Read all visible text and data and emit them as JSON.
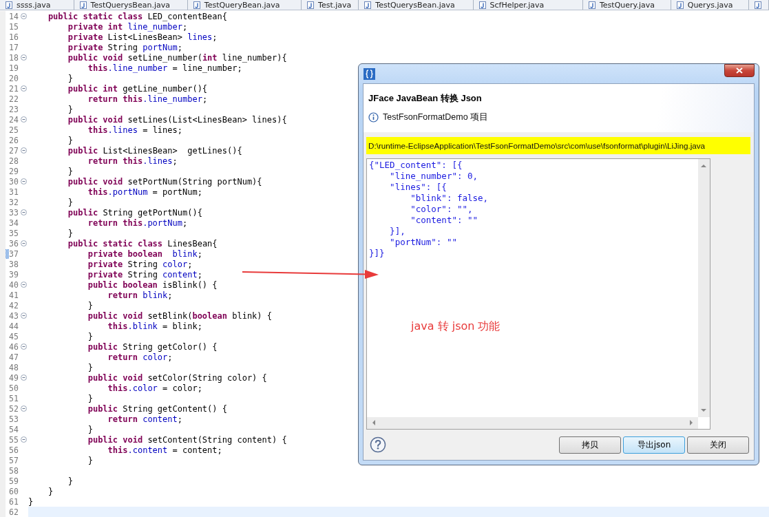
{
  "tabs": [
    {
      "label": "ssss.java",
      "selected": false
    },
    {
      "label": "TestQuerysBean.java",
      "selected": false
    },
    {
      "label": "TestQueryBean.java",
      "selected": false
    },
    {
      "label": "Test.java",
      "selected": false
    },
    {
      "label": "TestQuerysBean.java",
      "selected": false
    },
    {
      "label": "ScfHelper.java",
      "selected": false
    },
    {
      "label": "TestQuery.java",
      "selected": false
    },
    {
      "label": "Querys.java",
      "selected": false
    },
    {
      "selected": false
    }
  ],
  "editor": {
    "lines": [
      {
        "number": "14",
        "fold": true,
        "marked": false,
        "current": false,
        "segments": [
          {
            "kind": "kw",
            "text": "    public static class"
          },
          {
            "kind": "plain",
            "text": " LED_contentBean{"
          }
        ]
      },
      {
        "number": "15",
        "fold": false,
        "marked": false,
        "current": false,
        "segments": [
          {
            "kind": "kw",
            "text": "        private int"
          },
          {
            "kind": "field",
            "text": " line_number"
          },
          {
            "kind": "plain",
            "text": ";"
          }
        ]
      },
      {
        "number": "16",
        "fold": false,
        "marked": false,
        "current": false,
        "segments": [
          {
            "kind": "kw",
            "text": "        private"
          },
          {
            "kind": "plain",
            "text": " List<LinesBean>"
          },
          {
            "kind": "field",
            "text": " lines"
          },
          {
            "kind": "plain",
            "text": ";"
          }
        ]
      },
      {
        "number": "17",
        "fold": false,
        "marked": false,
        "current": false,
        "segments": [
          {
            "kind": "kw",
            "text": "        private"
          },
          {
            "kind": "plain",
            "text": " String"
          },
          {
            "kind": "field",
            "text": " portNum"
          },
          {
            "kind": "plain",
            "text": ";"
          }
        ]
      },
      {
        "number": "18",
        "fold": true,
        "marked": false,
        "current": false,
        "segments": [
          {
            "kind": "kw",
            "text": "        public void"
          },
          {
            "kind": "plain",
            "text": " setLine_number("
          },
          {
            "kind": "kw",
            "text": "int"
          },
          {
            "kind": "plain",
            "text": " line_number){"
          }
        ]
      },
      {
        "number": "19",
        "fold": false,
        "marked": false,
        "current": false,
        "segments": [
          {
            "kind": "kw",
            "text": "            this"
          },
          {
            "kind": "field",
            "text": ".line_number"
          },
          {
            "kind": "plain",
            "text": " = line_number;"
          }
        ]
      },
      {
        "number": "20",
        "fold": false,
        "marked": false,
        "current": false,
        "segments": [
          {
            "kind": "plain",
            "text": "        }"
          }
        ]
      },
      {
        "number": "21",
        "fold": true,
        "marked": false,
        "current": false,
        "segments": [
          {
            "kind": "kw",
            "text": "        public int"
          },
          {
            "kind": "plain",
            "text": " getLine_number(){"
          }
        ]
      },
      {
        "number": "22",
        "fold": false,
        "marked": false,
        "current": false,
        "segments": [
          {
            "kind": "kw",
            "text": "            return this"
          },
          {
            "kind": "field",
            "text": ".line_number"
          },
          {
            "kind": "plain",
            "text": ";"
          }
        ]
      },
      {
        "number": "23",
        "fold": false,
        "marked": false,
        "current": false,
        "segments": [
          {
            "kind": "plain",
            "text": "        }"
          }
        ]
      },
      {
        "number": "24",
        "fold": true,
        "marked": false,
        "current": false,
        "segments": [
          {
            "kind": "kw",
            "text": "        public void"
          },
          {
            "kind": "plain",
            "text": " setLines(List<LinesBean> lines){"
          }
        ]
      },
      {
        "number": "25",
        "fold": false,
        "marked": false,
        "current": false,
        "segments": [
          {
            "kind": "kw",
            "text": "            this"
          },
          {
            "kind": "field",
            "text": ".lines"
          },
          {
            "kind": "plain",
            "text": " = lines;"
          }
        ]
      },
      {
        "number": "26",
        "fold": false,
        "marked": false,
        "current": false,
        "segments": [
          {
            "kind": "plain",
            "text": "        }"
          }
        ]
      },
      {
        "number": "27",
        "fold": true,
        "marked": false,
        "current": false,
        "segments": [
          {
            "kind": "kw",
            "text": "        public"
          },
          {
            "kind": "plain",
            "text": " List<LinesBean>  getLines(){"
          }
        ]
      },
      {
        "number": "28",
        "fold": false,
        "marked": false,
        "current": false,
        "segments": [
          {
            "kind": "kw",
            "text": "            return this"
          },
          {
            "kind": "field",
            "text": ".lines"
          },
          {
            "kind": "plain",
            "text": ";"
          }
        ]
      },
      {
        "number": "29",
        "fold": false,
        "marked": false,
        "current": false,
        "segments": [
          {
            "kind": "plain",
            "text": "        }"
          }
        ]
      },
      {
        "number": "30",
        "fold": true,
        "marked": false,
        "current": false,
        "segments": [
          {
            "kind": "kw",
            "text": "        public void"
          },
          {
            "kind": "plain",
            "text": " setPortNum(String portNum){"
          }
        ]
      },
      {
        "number": "31",
        "fold": false,
        "marked": false,
        "current": false,
        "segments": [
          {
            "kind": "kw",
            "text": "            this"
          },
          {
            "kind": "field",
            "text": ".portNum"
          },
          {
            "kind": "plain",
            "text": " = portNum;"
          }
        ]
      },
      {
        "number": "32",
        "fold": false,
        "marked": false,
        "current": false,
        "segments": [
          {
            "kind": "plain",
            "text": "        }"
          }
        ]
      },
      {
        "number": "33",
        "fold": true,
        "marked": false,
        "current": false,
        "segments": [
          {
            "kind": "kw",
            "text": "        public"
          },
          {
            "kind": "plain",
            "text": " String getPortNum(){"
          }
        ]
      },
      {
        "number": "34",
        "fold": false,
        "marked": false,
        "current": false,
        "segments": [
          {
            "kind": "kw",
            "text": "            return this"
          },
          {
            "kind": "field",
            "text": ".portNum"
          },
          {
            "kind": "plain",
            "text": ";"
          }
        ]
      },
      {
        "number": "35",
        "fold": false,
        "marked": false,
        "current": false,
        "segments": [
          {
            "kind": "plain",
            "text": "        }"
          }
        ]
      },
      {
        "number": "36",
        "fold": true,
        "marked": false,
        "current": false,
        "segments": [
          {
            "kind": "kw",
            "text": "        public static class"
          },
          {
            "kind": "plain",
            "text": " LinesBean{"
          }
        ]
      },
      {
        "number": "37",
        "fold": false,
        "marked": true,
        "current": false,
        "segments": [
          {
            "kind": "kw",
            "text": "            private boolean"
          },
          {
            "kind": "field",
            "text": "  blink"
          },
          {
            "kind": "plain",
            "text": ";"
          }
        ]
      },
      {
        "number": "38",
        "fold": false,
        "marked": false,
        "current": false,
        "segments": [
          {
            "kind": "kw",
            "text": "            private"
          },
          {
            "kind": "plain",
            "text": " String"
          },
          {
            "kind": "field",
            "text": " color"
          },
          {
            "kind": "plain",
            "text": ";"
          }
        ]
      },
      {
        "number": "39",
        "fold": false,
        "marked": false,
        "current": false,
        "segments": [
          {
            "kind": "kw",
            "text": "            private"
          },
          {
            "kind": "plain",
            "text": " String"
          },
          {
            "kind": "field",
            "text": " content"
          },
          {
            "kind": "plain",
            "text": ";"
          }
        ]
      },
      {
        "number": "40",
        "fold": true,
        "marked": false,
        "current": false,
        "segments": [
          {
            "kind": "kw",
            "text": "            public boolean"
          },
          {
            "kind": "plain",
            "text": " isBlink() {"
          }
        ]
      },
      {
        "number": "41",
        "fold": false,
        "marked": false,
        "current": false,
        "segments": [
          {
            "kind": "kw",
            "text": "                return"
          },
          {
            "kind": "field",
            "text": " blink"
          },
          {
            "kind": "plain",
            "text": ";"
          }
        ]
      },
      {
        "number": "42",
        "fold": false,
        "marked": false,
        "current": false,
        "segments": [
          {
            "kind": "plain",
            "text": "            }"
          }
        ]
      },
      {
        "number": "43",
        "fold": true,
        "marked": false,
        "current": false,
        "segments": [
          {
            "kind": "kw",
            "text": "            public void"
          },
          {
            "kind": "plain",
            "text": " setBlink("
          },
          {
            "kind": "kw",
            "text": "boolean"
          },
          {
            "kind": "plain",
            "text": " blink) {"
          }
        ]
      },
      {
        "number": "44",
        "fold": false,
        "marked": false,
        "current": false,
        "segments": [
          {
            "kind": "kw",
            "text": "                this"
          },
          {
            "kind": "field",
            "text": ".blink"
          },
          {
            "kind": "plain",
            "text": " = blink;"
          }
        ]
      },
      {
        "number": "45",
        "fold": false,
        "marked": false,
        "current": false,
        "segments": [
          {
            "kind": "plain",
            "text": "            }"
          }
        ]
      },
      {
        "number": "46",
        "fold": true,
        "marked": false,
        "current": false,
        "segments": [
          {
            "kind": "kw",
            "text": "            public"
          },
          {
            "kind": "plain",
            "text": " String getColor() {"
          }
        ]
      },
      {
        "number": "47",
        "fold": false,
        "marked": false,
        "current": false,
        "segments": [
          {
            "kind": "kw",
            "text": "                return"
          },
          {
            "kind": "field",
            "text": " color"
          },
          {
            "kind": "plain",
            "text": ";"
          }
        ]
      },
      {
        "number": "48",
        "fold": false,
        "marked": false,
        "current": false,
        "segments": [
          {
            "kind": "plain",
            "text": "            }"
          }
        ]
      },
      {
        "number": "49",
        "fold": true,
        "marked": false,
        "current": false,
        "segments": [
          {
            "kind": "kw",
            "text": "            public void"
          },
          {
            "kind": "plain",
            "text": " setColor(String color) {"
          }
        ]
      },
      {
        "number": "50",
        "fold": false,
        "marked": false,
        "current": false,
        "segments": [
          {
            "kind": "kw",
            "text": "                this"
          },
          {
            "kind": "field",
            "text": ".color"
          },
          {
            "kind": "plain",
            "text": " = color;"
          }
        ]
      },
      {
        "number": "51",
        "fold": false,
        "marked": false,
        "current": false,
        "segments": [
          {
            "kind": "plain",
            "text": "            }"
          }
        ]
      },
      {
        "number": "52",
        "fold": true,
        "marked": false,
        "current": false,
        "segments": [
          {
            "kind": "kw",
            "text": "            public"
          },
          {
            "kind": "plain",
            "text": " String getContent() {"
          }
        ]
      },
      {
        "number": "53",
        "fold": false,
        "marked": false,
        "current": false,
        "segments": [
          {
            "kind": "kw",
            "text": "                return"
          },
          {
            "kind": "field",
            "text": " content"
          },
          {
            "kind": "plain",
            "text": ";"
          }
        ]
      },
      {
        "number": "54",
        "fold": false,
        "marked": false,
        "current": false,
        "segments": [
          {
            "kind": "plain",
            "text": "            }"
          }
        ]
      },
      {
        "number": "55",
        "fold": true,
        "marked": false,
        "current": false,
        "segments": [
          {
            "kind": "kw",
            "text": "            public void"
          },
          {
            "kind": "plain",
            "text": " setContent(String content) {"
          }
        ]
      },
      {
        "number": "56",
        "fold": false,
        "marked": false,
        "current": false,
        "segments": [
          {
            "kind": "kw",
            "text": "                this"
          },
          {
            "kind": "field",
            "text": ".content"
          },
          {
            "kind": "plain",
            "text": " = content;"
          }
        ]
      },
      {
        "number": "57",
        "fold": false,
        "marked": false,
        "current": false,
        "segments": [
          {
            "kind": "plain",
            "text": "            }"
          }
        ]
      },
      {
        "number": "58",
        "fold": false,
        "marked": false,
        "current": false
      },
      {
        "number": "59",
        "fold": false,
        "marked": false,
        "current": false,
        "segments": [
          {
            "kind": "plain",
            "text": "        }"
          }
        ]
      },
      {
        "number": "60",
        "fold": false,
        "marked": false,
        "current": false,
        "segments": [
          {
            "kind": "plain",
            "text": "    }"
          }
        ]
      },
      {
        "number": "61",
        "fold": false,
        "marked": false,
        "current": false,
        "segments": [
          {
            "kind": "plain",
            "text": "}"
          }
        ]
      },
      {
        "number": "62",
        "fold": false,
        "marked": false,
        "current": true
      }
    ]
  },
  "dialog": {
    "title": "JFace JavaBean 转换 Json",
    "message": "TestFsonFormatDemo 项目",
    "path": "D:\\runtime-EclipseApplication\\TestFsonFormatDemo\\src\\com\\use\\fsonformat\\plugin\\LiJing.java",
    "json_text": [
      "{\"LED_content\": [{",
      "    \"line_number\": 0,",
      "    \"lines\": [{",
      "        \"blink\": false,",
      "        \"color\": \"\",",
      "        \"content\": \"\"",
      "    }],",
      "    \"portNum\": \"\"",
      "}]}"
    ],
    "buttons": [
      {
        "label": "拷贝",
        "focused": false
      },
      {
        "label": "导出json",
        "focused": true
      },
      {
        "label": "关闭",
        "focused": false
      }
    ]
  },
  "annotation": {
    "text": "java 转 json 功能"
  }
}
